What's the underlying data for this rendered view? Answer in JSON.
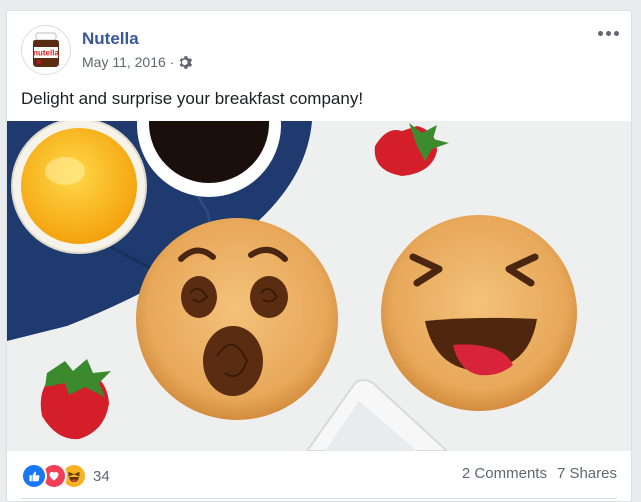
{
  "post": {
    "page_name": "Nutella",
    "date": "May 11, 2016",
    "separator": "·",
    "caption": "Delight and surprise your breakfast company!",
    "avatar_icon": "nutella-jar-icon",
    "privacy_icon": "gear-icon"
  },
  "photo": {
    "description_icons": [
      "orange-juice-glass",
      "coffee-cup",
      "strawberry",
      "pancake-surprised-face",
      "pancake-laughing-face",
      "napkin"
    ]
  },
  "footer": {
    "reactions": [
      "like-icon",
      "love-icon",
      "haha-icon"
    ],
    "reaction_count": "34",
    "comments": "2 Comments",
    "shares": "7 Shares"
  },
  "colors": {
    "link": "#385898",
    "like": "#1877f2",
    "love": "#f33e58",
    "haha": "#f7b125"
  }
}
